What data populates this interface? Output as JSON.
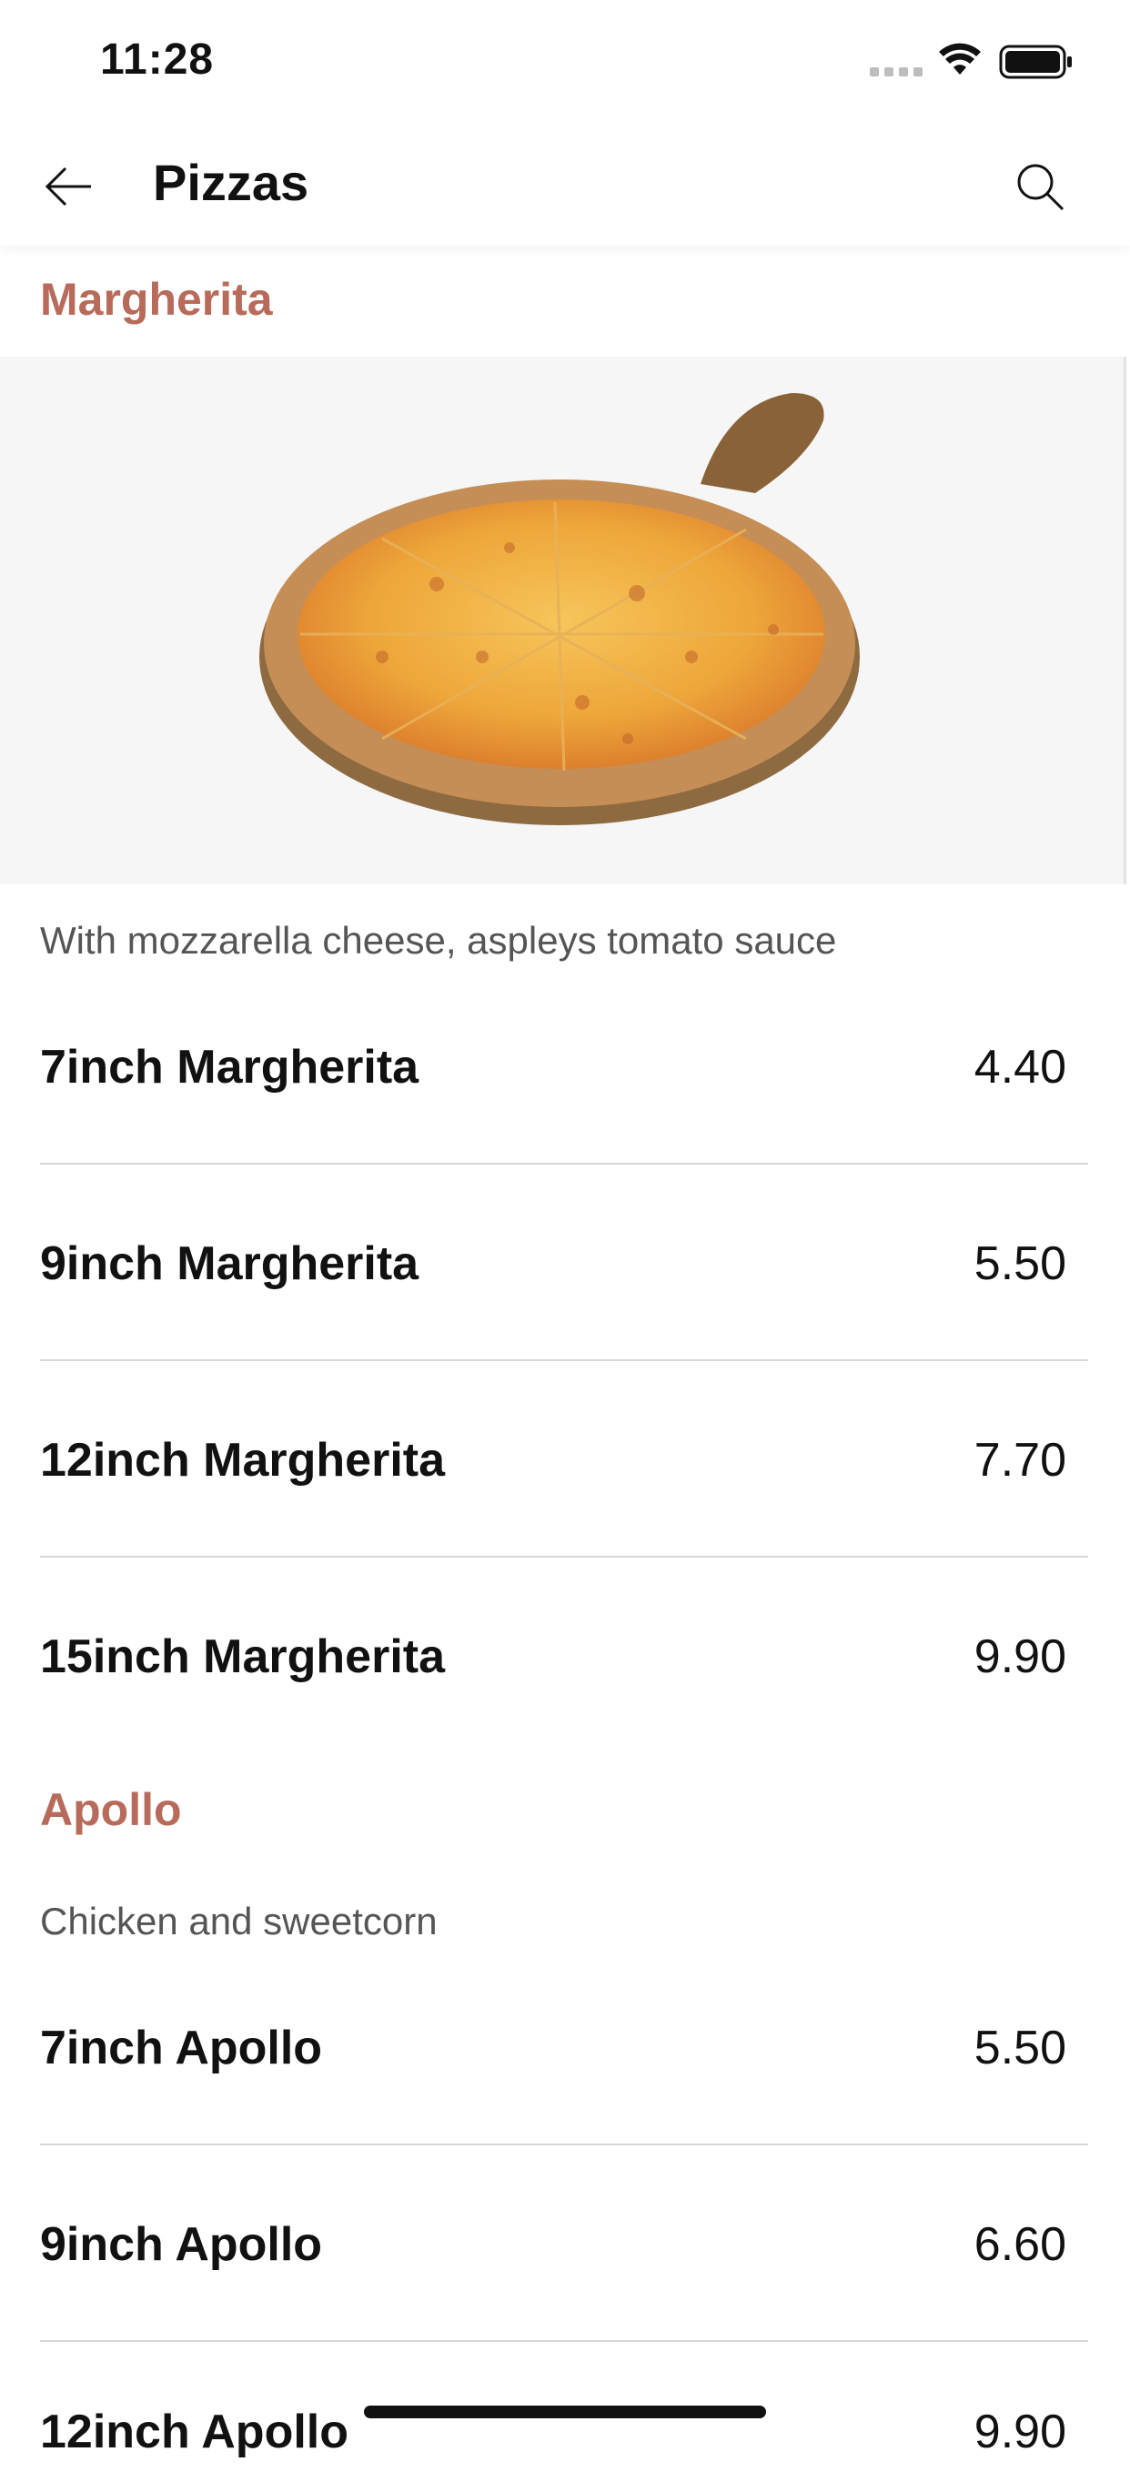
{
  "status": {
    "time": "11:28"
  },
  "header": {
    "title": "Pizzas",
    "back_icon": "arrow-left-icon",
    "search_icon": "search-icon"
  },
  "sections": [
    {
      "title": "Margherita",
      "description": "With mozzarella cheese, aspleys tomato sauce",
      "items": [
        {
          "name": "7inch Margherita",
          "price": "4.40"
        },
        {
          "name": "9inch Margherita",
          "price": "5.50"
        },
        {
          "name": "12inch Margherita",
          "price": "7.70"
        },
        {
          "name": "15inch Margherita",
          "price": "9.90"
        }
      ]
    },
    {
      "title": "Apollo",
      "description": "Chicken and sweetcorn",
      "items": [
        {
          "name": "7inch Apollo",
          "price": "5.50"
        },
        {
          "name": "9inch Apollo",
          "price": "6.60"
        },
        {
          "name": "12inch Apollo",
          "price": "9.90"
        }
      ]
    }
  ],
  "colors": {
    "accent": "#b86b5b",
    "divider": "#d7d7d7",
    "hero_bg": "#f6f6f6"
  }
}
